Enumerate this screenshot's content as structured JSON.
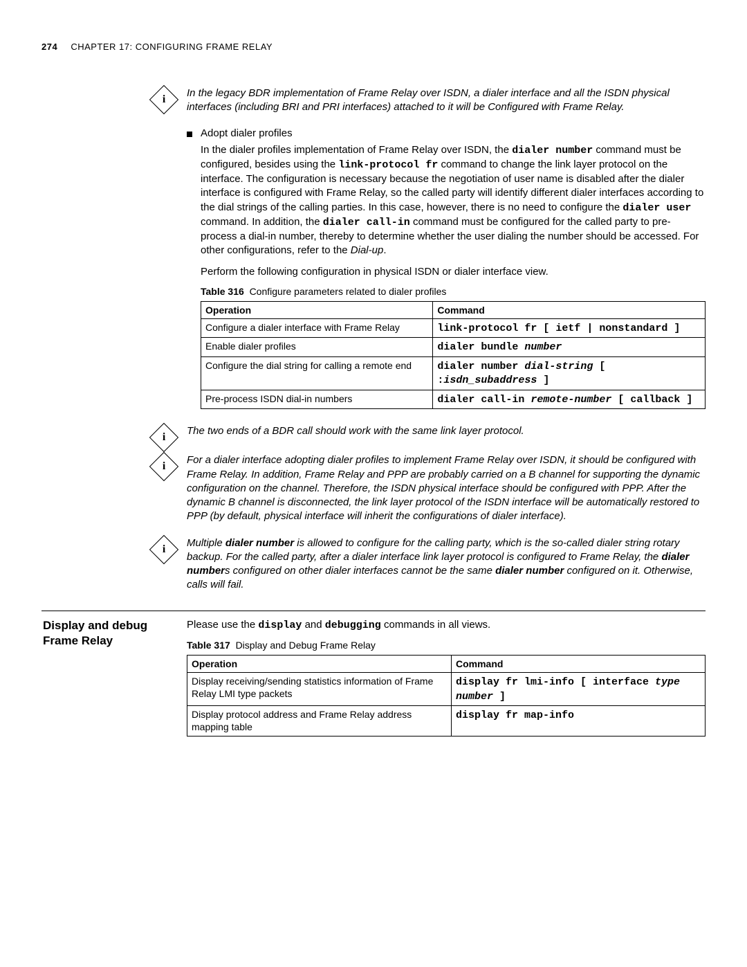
{
  "header": {
    "pagenum": "274",
    "chapter": "CHAPTER 17: CONFIGURING FRAME RELAY"
  },
  "note1": "In the legacy BDR implementation of Frame Relay over ISDN, a dialer interface and all the ISDN physical interfaces (including BRI and PRI interfaces) attached to it will be Configured with Frame Relay.",
  "bullet1": "Adopt dialer profiles",
  "para_prefix": "In the dialer profiles implementation of Frame Relay over ISDN, the ",
  "mono_dialer_number": "dialer number",
  "para_mid1": " command must be configured, besides using the ",
  "mono_link_protocol": "link-protocol fr",
  "para_mid2": " command to change the link layer protocol on the interface. The configuration is necessary because the negotiation of user name is disabled after the dialer interface is configured with Frame Relay, so the called party will identify different dialer interfaces according to the dial strings of the calling parties. In this case, however, there is no need to configure the ",
  "mono_dialer_user": "dialer user",
  "para_mid3": " command. In addition, the ",
  "mono_dialer_callin": "dialer call-in",
  "para_end": " command must be configured for the called party to pre-process a dial-in number, thereby to determine whether the user dialing the number should be accessed. For other configurations, refer to the ",
  "dialup_ref": "Dial-up",
  "perform_line": "Perform the following configuration in physical ISDN or dialer interface view.",
  "table316": {
    "label": "Table 316",
    "caption": "Configure parameters related to dialer profiles",
    "col_op": "Operation",
    "col_cmd": "Command",
    "rows": [
      {
        "op": "Configure a dialer interface with Frame Relay",
        "cmd": "link-protocol fr [ ietf | nonstandard ]"
      },
      {
        "op": "Enable dialer profiles",
        "cmd_pre": "dialer bundle ",
        "cmd_it": "number"
      },
      {
        "op": "Configure the dial string for calling a remote end",
        "cmd_pre": "dialer number ",
        "cmd_it1": "dial-string",
        "cmd_mid": " [ :",
        "cmd_it2": "isdn_subaddress",
        "cmd_suf": " ]"
      },
      {
        "op": "Pre-process ISDN dial-in numbers",
        "cmd_pre": "dialer call-in ",
        "cmd_it": "remote-number",
        "cmd_suf": " [ callback ]"
      }
    ]
  },
  "note2": "The two ends of a BDR call should work with the same link layer protocol.",
  "note3": "For a dialer interface adopting dialer profiles to implement Frame Relay over ISDN, it should be configured with Frame Relay. In addition, Frame Relay and PPP are probably carried on a B channel for supporting the dynamic configuration on the channel. Therefore, the ISDN physical interface should be configured with PPP. After the dynamic B channel is disconnected, the link layer protocol of the ISDN interface will be automatically restored to PPP (by default, physical interface will inherit the configurations of dialer interface).",
  "note4_pre": "Multiple ",
  "note4_b1": "dialer number",
  "note4_mid1": " is allowed to configure for the calling party, which is the so-called dialer string rotary backup. For the called party, after a dialer interface link layer protocol is configured to Frame Relay, the ",
  "note4_b2": "dialer number",
  "note4_mid2": "s configured on other dialer interfaces cannot be the same ",
  "note4_b3": "dialer number",
  "note4_end": " configured on it. Otherwise, calls will fail.",
  "section2_heading1": "Display and debug",
  "section2_heading2": "Frame Relay",
  "section2_intro_pre": "Please use the ",
  "section2_mono1": "display",
  "section2_intro_mid": " and ",
  "section2_mono2": "debugging",
  "section2_intro_end": " commands in all views.",
  "table317": {
    "label": "Table 317",
    "caption": "Display and Debug Frame Relay",
    "col_op": "Operation",
    "col_cmd": "Command",
    "rows": [
      {
        "op": "Display receiving/sending statistics information of Frame Relay LMI type packets",
        "cmd_pre": "display fr lmi-info [ interface ",
        "cmd_it": "type number",
        "cmd_suf": " ]"
      },
      {
        "op": "Display protocol address and Frame Relay address mapping table",
        "cmd": "display fr map-info"
      }
    ]
  }
}
